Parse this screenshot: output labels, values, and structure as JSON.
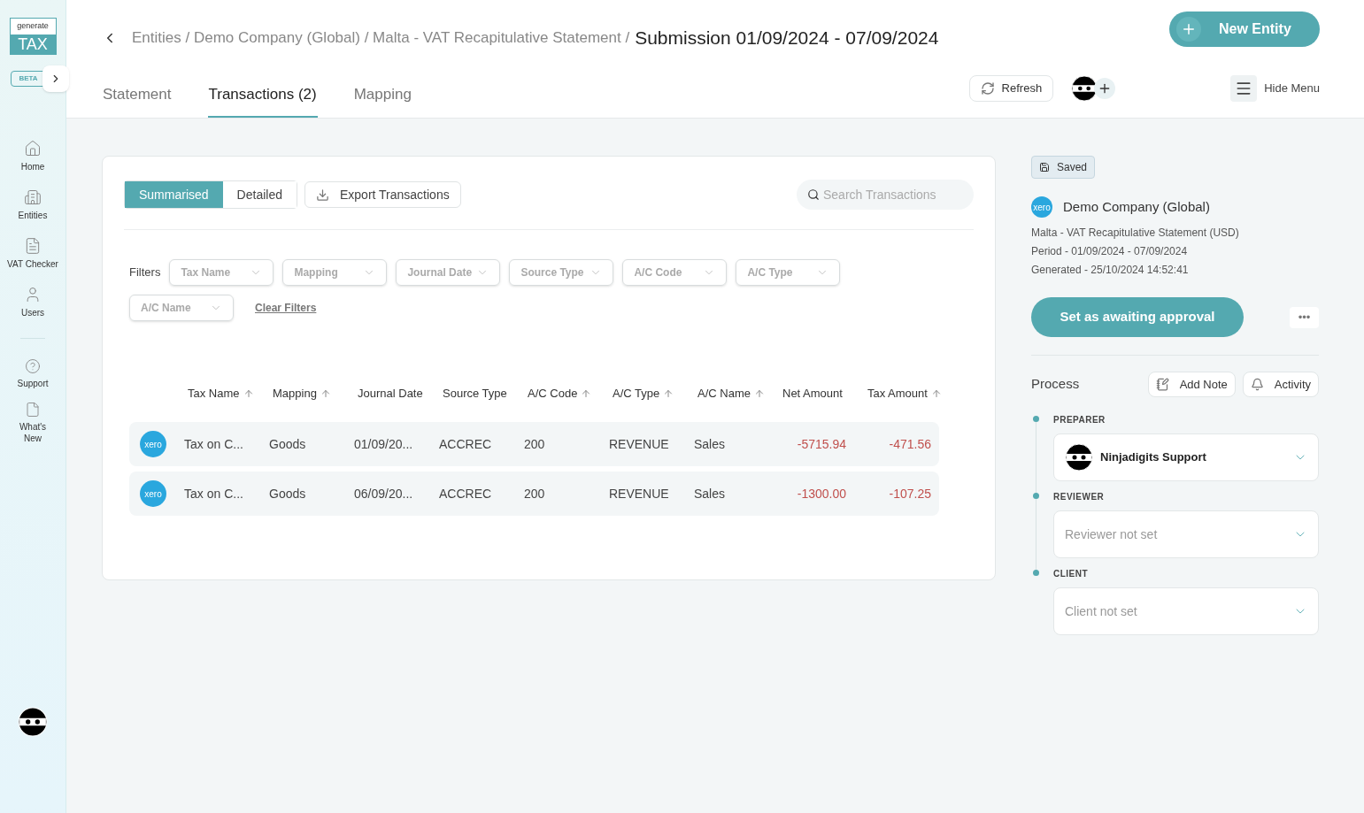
{
  "logo": {
    "top": "generate",
    "bottom": "TAX",
    "badge": "BETA"
  },
  "sidebar": {
    "items": [
      {
        "label": "Home"
      },
      {
        "label": "Entities"
      },
      {
        "label": "VAT Checker"
      },
      {
        "label": "Users"
      }
    ],
    "bottom_items": [
      {
        "label": "Support"
      },
      {
        "label": "What's New"
      }
    ]
  },
  "header": {
    "breadcrumb": "Entities / Demo Company (Global) / Malta - VAT Recapitulative Statement /",
    "title": "Submission 01/09/2024 - 07/09/2024",
    "new_button": "New Entity",
    "refresh": "Refresh",
    "hide_menu": "Hide Menu"
  },
  "tabs": [
    {
      "label": "Statement",
      "selected": false
    },
    {
      "label": "Transactions (2)",
      "selected": true
    },
    {
      "label": "Mapping",
      "selected": false
    }
  ],
  "view_toggle": [
    {
      "label": "Summarised",
      "selected": true
    },
    {
      "label": "Detailed",
      "selected": false
    }
  ],
  "export_button": "Export Transactions",
  "search": {
    "placeholder": "Search Transactions"
  },
  "filters": {
    "label": "Filters",
    "items": [
      "Tax Name",
      "Mapping",
      "Journal Date",
      "Source Type",
      "A/C Code",
      "A/C Type",
      "A/C Name"
    ],
    "clear": "Clear Filters"
  },
  "table": {
    "columns": [
      {
        "label": "Tax Name",
        "sortable": true
      },
      {
        "label": "Mapping",
        "sortable": true
      },
      {
        "label": "Journal Date",
        "sortable": false
      },
      {
        "label": "Source Type",
        "sortable": false
      },
      {
        "label": "A/C Code",
        "sortable": true
      },
      {
        "label": "A/C Type",
        "sortable": true
      },
      {
        "label": "A/C Name",
        "sortable": true
      },
      {
        "label": "Net Amount",
        "sortable": false
      },
      {
        "label": "Tax Amount",
        "sortable": true
      }
    ],
    "rows": [
      {
        "source": "xero",
        "cells": [
          "Tax on C...",
          "Goods",
          "01/09/20...",
          "ACCREC",
          "200",
          "REVENUE",
          "Sales",
          "-5715.94",
          "-471.56"
        ]
      },
      {
        "source": "xero",
        "cells": [
          "Tax on C...",
          "Goods",
          "06/09/20...",
          "ACCREC",
          "200",
          "REVENUE",
          "Sales",
          "-1300.00",
          "-107.25"
        ]
      }
    ]
  },
  "panel": {
    "status": "Saved",
    "company_logo": "xero",
    "company": "Demo Company (Global)",
    "lines": [
      "Malta - VAT Recapitulative Statement (USD)",
      "Period - 01/09/2024 - 07/09/2024",
      "Generated - 25/10/2024 14:52:41"
    ],
    "action": "Set as awaiting approval",
    "more": "•••",
    "process": "Process",
    "add_note": "Add Note",
    "activity": "Activity",
    "steps": [
      {
        "label": "PREPARER",
        "value": "Ninjadigits Support",
        "set": true
      },
      {
        "label": "REVIEWER",
        "value": "Reviewer not set",
        "set": false
      },
      {
        "label": "CLIENT",
        "value": "Client not set",
        "set": false
      }
    ]
  }
}
